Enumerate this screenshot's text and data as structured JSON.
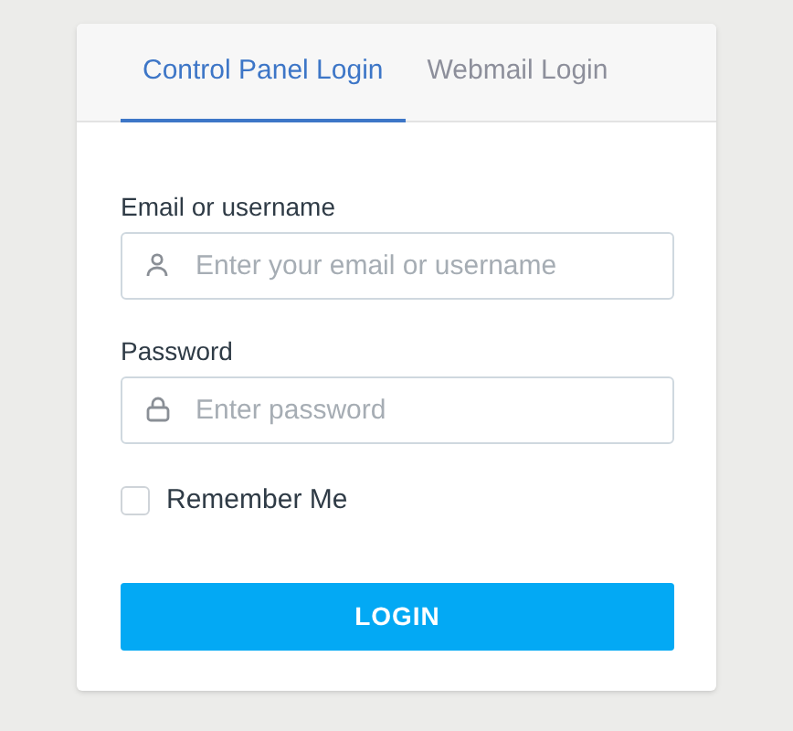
{
  "tabs": [
    {
      "label": "Control Panel Login",
      "selected": true
    },
    {
      "label": "Webmail Login",
      "selected": false
    }
  ],
  "fields": [
    {
      "label": "Email or username",
      "kind": "text",
      "placeholder": "Enter your email or username"
    },
    {
      "label": "Password",
      "kind": "password",
      "placeholder": "Enter password"
    }
  ],
  "remember": {
    "label": "Remember Me",
    "checked": false
  },
  "login_button": "LOGIN"
}
